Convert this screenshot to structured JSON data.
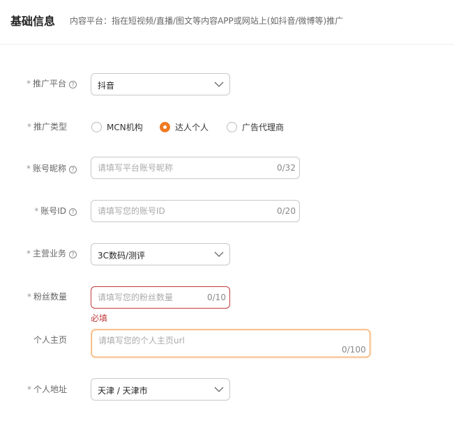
{
  "header": {
    "title": "基础信息",
    "description": "内容平台：指在短视频/直播/图文等内容APP或网站上(如抖音/微博等)推广"
  },
  "form": {
    "platform": {
      "label": "推广平台",
      "value": "抖音"
    },
    "promo_type": {
      "label": "推广类型",
      "options": [
        "MCN机构",
        "达人个人",
        "广告代理商"
      ],
      "selected": "达人个人"
    },
    "nickname": {
      "label": "账号昵称",
      "placeholder": "请填写平台账号昵称",
      "counter": "0/32"
    },
    "account_id": {
      "label": "账号ID",
      "placeholder": "请填写您的账号ID",
      "counter": "0/20"
    },
    "main_business": {
      "label": "主营业务",
      "value": "3C数码/测评"
    },
    "fans": {
      "label": "粉丝数量",
      "placeholder": "请填写您的粉丝数量",
      "counter": "0/10",
      "error": "必填"
    },
    "homepage": {
      "label": "个人主页",
      "placeholder": "请填写您的个人主页url",
      "counter": "0/100"
    },
    "address": {
      "label": "个人地址",
      "value": "天津 / 天津市"
    }
  },
  "colors": {
    "accent": "#f07a22",
    "error": "#c23a3a",
    "border": "#c8c8c8"
  }
}
